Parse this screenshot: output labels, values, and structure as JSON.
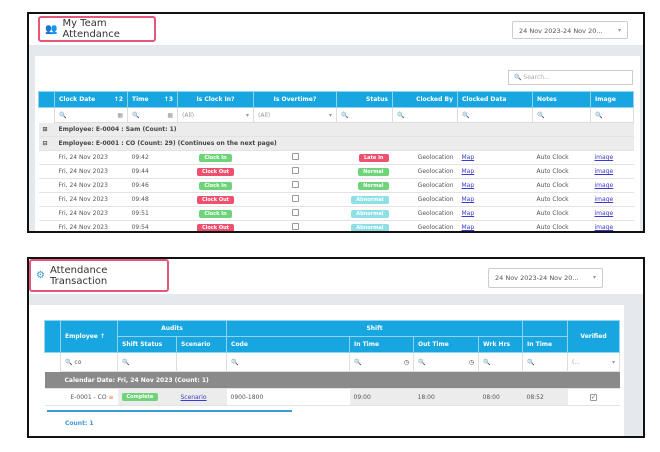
{
  "team": {
    "title": "My Team Attendance",
    "icon": "team-users-icon",
    "date_range": "24 Nov 2023-24 Nov 20...",
    "search_placeholder": "Search...",
    "columns": [
      "Clock Date",
      "Time",
      "Is Clock In?",
      "Is Overtime?",
      "Status",
      "Clocked By",
      "Clocked Data",
      "Notes",
      "Image"
    ],
    "sort": {
      "clock_date": "2",
      "time": "3"
    },
    "filter_all": "(All)",
    "groups": [
      "Employee: E-0004 : Sam (Count: 1)",
      "Employee: E-0001 : CO (Count: 29) (Continues on the next page)"
    ],
    "rows": [
      {
        "date": "Fri, 24 Nov 2023",
        "time": "09:42",
        "clock": "Clock In",
        "status": "Late In",
        "by": "Geolocation",
        "data": "Map",
        "notes": "Auto Clock",
        "image": "image"
      },
      {
        "date": "Fri, 24 Nov 2023",
        "time": "09:44",
        "clock": "Clock Out",
        "status": "Normal",
        "by": "Geolocation",
        "data": "Map",
        "notes": "Auto Clock",
        "image": "image"
      },
      {
        "date": "Fri, 24 Nov 2023",
        "time": "09:46",
        "clock": "Clock In",
        "status": "Normal",
        "by": "Geolocation",
        "data": "Map",
        "notes": "Auto Clock",
        "image": "image"
      },
      {
        "date": "Fri, 24 Nov 2023",
        "time": "09:48",
        "clock": "Clock Out",
        "status": "Abnormal",
        "by": "Geolocation",
        "data": "Map",
        "notes": "Auto Clock",
        "image": "image"
      },
      {
        "date": "Fri, 24 Nov 2023",
        "time": "09:51",
        "clock": "Clock In",
        "status": "Abnormal",
        "by": "Geolocation",
        "data": "Map",
        "notes": "Auto Clock",
        "image": "image"
      },
      {
        "date": "Fri, 24 Nov 2023",
        "time": "09:54",
        "clock": "Clock Out",
        "status": "Abnormal",
        "by": "Geolocation",
        "data": "Map",
        "notes": "Auto Clock",
        "image": "image"
      }
    ]
  },
  "trans": {
    "title": "Attendance Transaction",
    "icon": "attendance-transaction-icon",
    "date_range": "24 Nov 2023-24 Nov 20...",
    "headers": {
      "employee": "Employee",
      "audits": "Audits",
      "shift": "Shift",
      "verified": "Verified",
      "shift_status": "Shift Status",
      "scenario": "Scenario",
      "code": "Code",
      "in_time": "In Time",
      "out_time": "Out Time",
      "wrk_hrs": "Wrk Hrs",
      "in_time2": "In Time"
    },
    "employee_filter": "co",
    "verified_filter": "(...",
    "group": "Calendar Date: Fri, 24 Nov 2023 (Count: 1)",
    "row": {
      "employee": "E-0001 - CO",
      "shift_status": "Complete",
      "scenario": "Scenario",
      "code": "0900-1800",
      "in_time": "09:00",
      "out_time": "18:00",
      "wrk_hrs": "08:00",
      "in_time2": "08:52",
      "verified": true
    },
    "count": "Count: 1"
  },
  "colors": {
    "accent": "#17a6e0",
    "clock_in": "#6fd37a",
    "clock_out": "#f0506e",
    "late_in": "#f0506e",
    "normal": "#6fd37a",
    "abnormal": "#8fe0e6",
    "highlight": "#e4577a"
  }
}
